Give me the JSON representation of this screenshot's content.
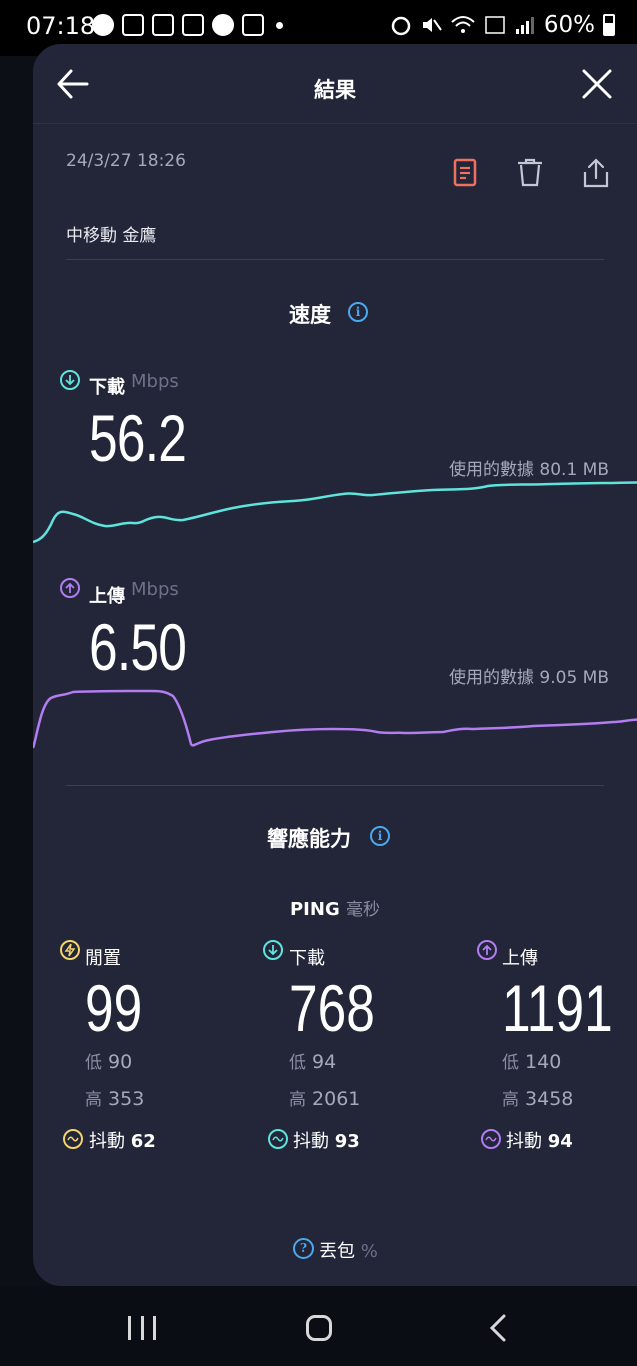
{
  "status_bar": {
    "time": "07:18",
    "battery": "60%"
  },
  "header": {
    "title": "結果"
  },
  "result": {
    "datetime": "24/3/27 18:26",
    "carrier": "中移動 金鷹"
  },
  "speed": {
    "section_title": "速度",
    "download": {
      "label": "下載",
      "unit": "Mbps",
      "value": "56.2",
      "data_used": "使用的數據 80.1 MB"
    },
    "upload": {
      "label": "上傳",
      "unit": "Mbps",
      "value": "6.50",
      "data_used": "使用的數據 9.05 MB"
    }
  },
  "responsiveness": {
    "section_title": "響應能力",
    "ping_title": "PING",
    "ping_unit": "毫秒",
    "low_label": "低",
    "high_label": "高",
    "jitter_label": "抖動",
    "columns": [
      {
        "label": "閒置",
        "value": "99",
        "low": "90",
        "high": "353",
        "jitter": "62",
        "color": "#f3d36b"
      },
      {
        "label": "下載",
        "value": "768",
        "low": "94",
        "high": "2061",
        "jitter": "93",
        "color": "#5fe3dd"
      },
      {
        "label": "上傳",
        "value": "1191",
        "low": "140",
        "high": "3458",
        "jitter": "94",
        "color": "#b17df0"
      }
    ],
    "packet_loss_label": "丟包",
    "packet_loss_unit": "%"
  },
  "colors": {
    "download": "#5fe3dd",
    "upload": "#b17df0",
    "idle": "#f3d36b",
    "info": "#4aa9ee",
    "accent_report": "#f07060"
  },
  "icons": {
    "back": "arrow-left-icon",
    "close": "close-icon",
    "report": "document-icon",
    "delete": "trash-icon",
    "share": "share-icon"
  }
}
